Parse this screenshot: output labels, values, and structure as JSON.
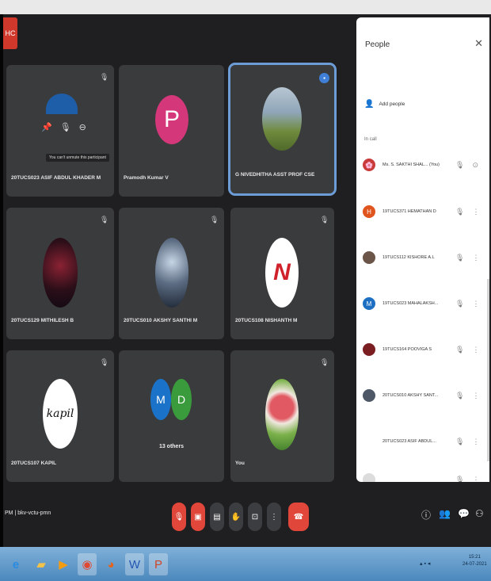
{
  "exit_badge": "HC",
  "tiles": [
    {
      "name": "20TUCS023 ASIF ABDUL KHADER M",
      "tooltip": "You can't unmute this participant"
    },
    {
      "name": "Pramodh Kumar V",
      "initial": "P",
      "avatar_color": "#d4377a"
    },
    {
      "name": "G NIVEDHITHA ASST PROF CSE"
    },
    {
      "name": "20TUCS129 MITHILESH B"
    },
    {
      "name": "20TUCS010 AKSHY SANTHI M"
    },
    {
      "name": "20TUCS108 NISHANTH M",
      "avatar_text": "N"
    },
    {
      "name": "20TUCS107 KAPIL",
      "avatar_text": "kapil"
    },
    {
      "name": "13 others",
      "initials": [
        "M",
        "D"
      ]
    },
    {
      "name": "You"
    }
  ],
  "people": {
    "title": "People",
    "add_people": "Add people",
    "in_call": "In call",
    "rows": [
      {
        "name": "Ms. S. SAKTHI SHAL... (You)",
        "color": "#c93a3a",
        "letter": ""
      },
      {
        "name": "19TUCS371 HEMATHAN D",
        "color": "#e0541e",
        "letter": "H"
      },
      {
        "name": "19TUCS112 KISHORE A.L",
        "color": "#6b5448",
        "letter": ""
      },
      {
        "name": "19TUCS023 MAHALAKSH...",
        "color": "#1d6fc2",
        "letter": "M"
      },
      {
        "name": "19TUCS164 POOVIGA S",
        "color": "#7a1e22",
        "letter": ""
      },
      {
        "name": "20TUCS010 AKSHY SANT...",
        "color": "#4d5766",
        "letter": ""
      },
      {
        "name": "20TUCS023 ASIF ABDUL...",
        "color": "#ffffff",
        "letter": ""
      },
      {
        "name": "",
        "color": "#dcdcdc",
        "letter": ""
      }
    ]
  },
  "meeting": {
    "time": "PM",
    "code": "bkv-vctu-pmn"
  },
  "tray": {
    "time": "15:21",
    "date": "24-07-2021"
  }
}
